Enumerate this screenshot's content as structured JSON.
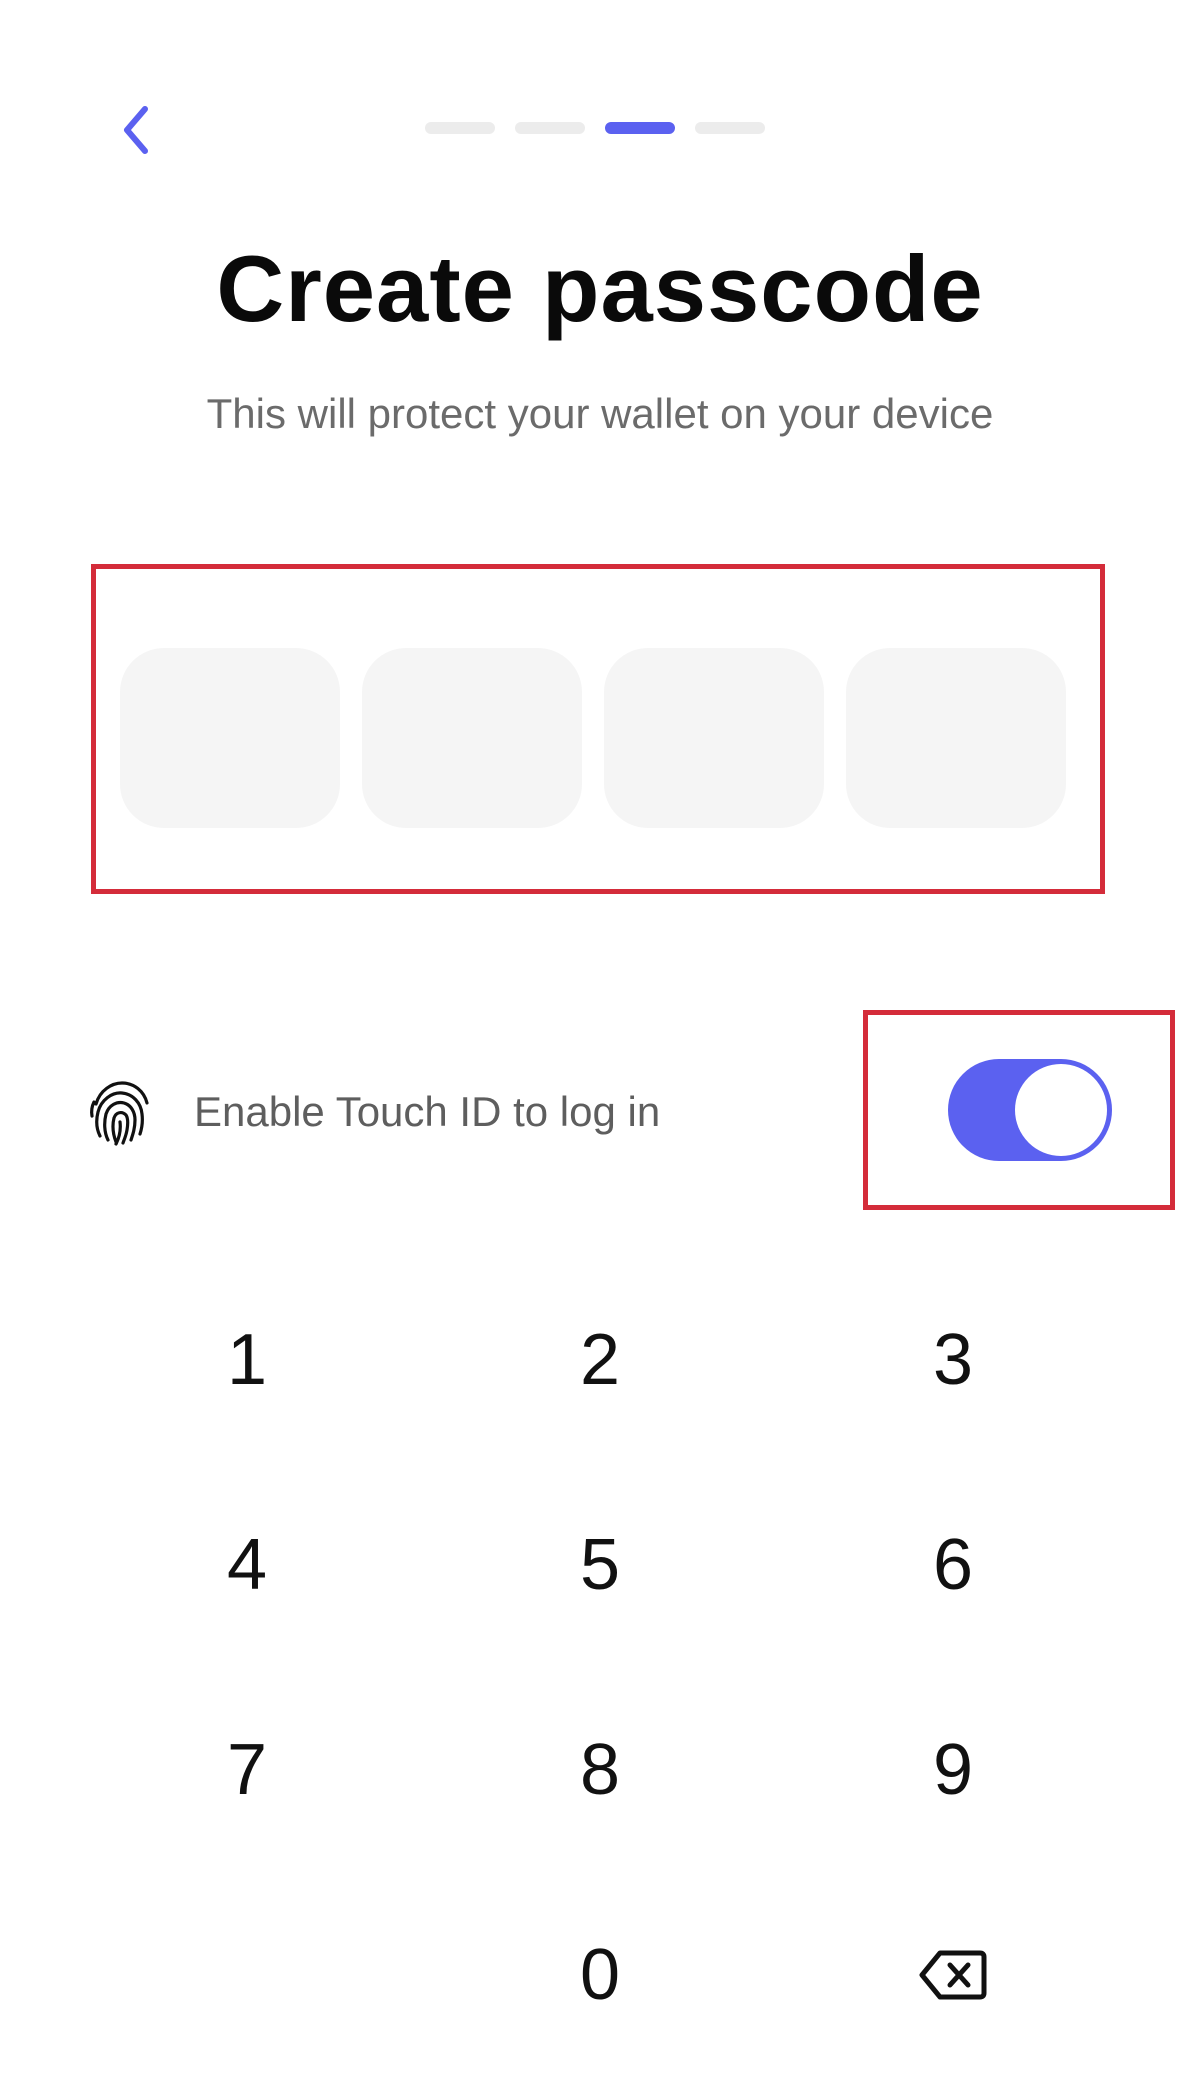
{
  "header": {
    "back_icon": "chevron-left-icon",
    "progress_steps": 4,
    "active_step": 3
  },
  "title": "Create passcode",
  "subtitle": "This will protect your wallet on your device",
  "passcode": {
    "digits_entered": 0,
    "length": 4
  },
  "touch_id": {
    "icon": "fingerprint-icon",
    "label": "Enable Touch ID to log in",
    "enabled": true
  },
  "keypad": {
    "keys": [
      "1",
      "2",
      "3",
      "4",
      "5",
      "6",
      "7",
      "8",
      "9",
      "0"
    ],
    "backspace_icon": "backspace-icon"
  },
  "colors": {
    "accent": "#5b61f0",
    "highlight_border": "#d42c3a",
    "slot_fill": "#f5f5f5"
  }
}
